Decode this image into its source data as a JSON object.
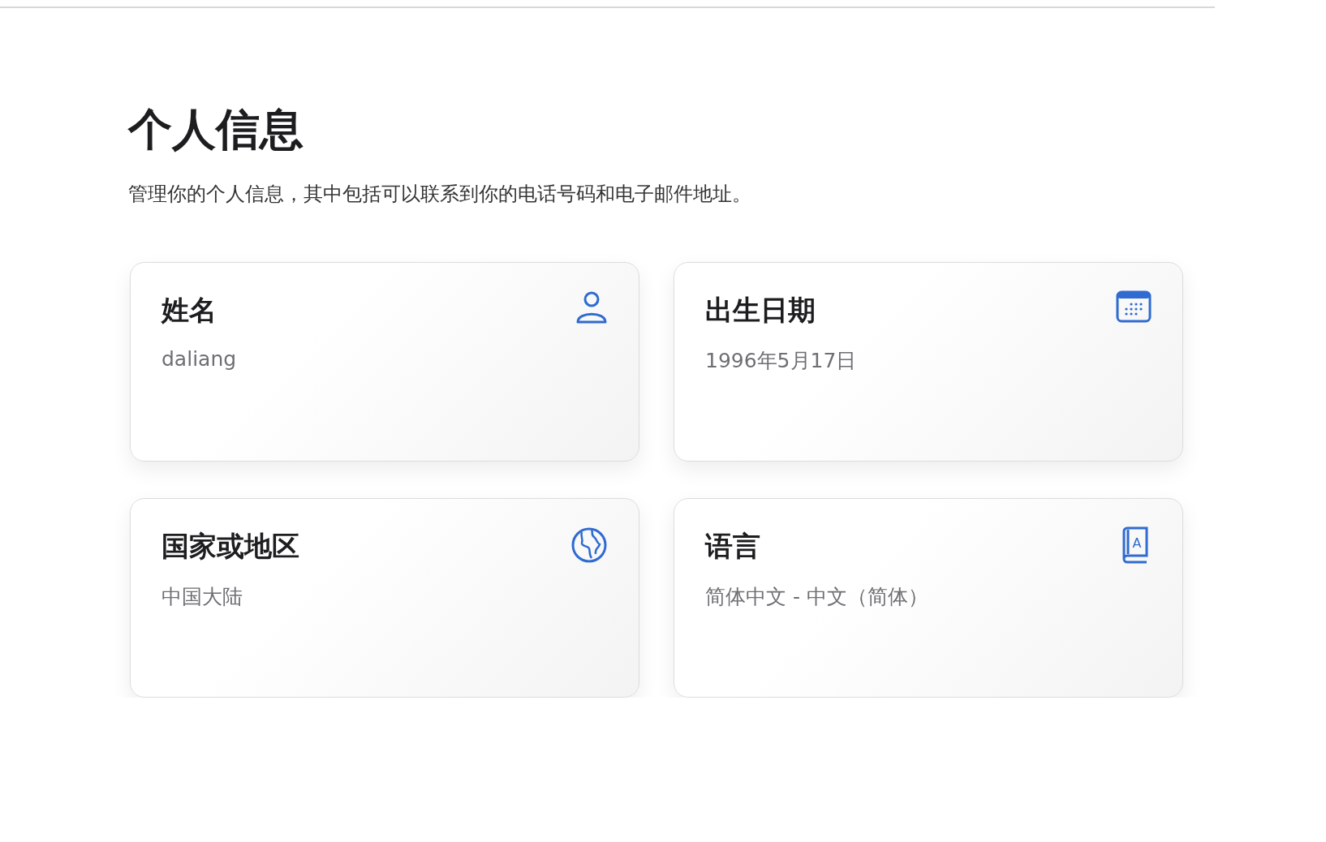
{
  "title": "个人信息",
  "description": "管理你的个人信息，其中包括可以联系到你的电话号码和电子邮件地址。",
  "cards": [
    {
      "kind": "person",
      "label": "姓名",
      "value": "daliang"
    },
    {
      "kind": "calendar",
      "label": "出生日期",
      "value": "1996年5月17日"
    },
    {
      "kind": "globe",
      "label": "国家或地区",
      "value": "中国大陆"
    },
    {
      "kind": "book",
      "label": "语言",
      "value": "简体中文 - 中文（简体）",
      "icon_letter": "A"
    }
  ]
}
